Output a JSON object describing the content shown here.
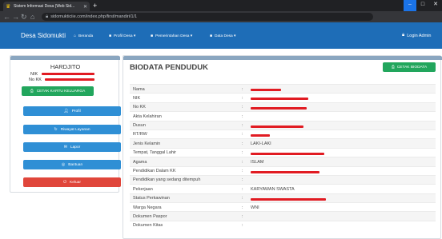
{
  "browser": {
    "tab_title": "Sistem Informasi Desa (Web Sid...",
    "url": "sidomukticiie.com/index.php/first/mandiri/1/1"
  },
  "navbar": {
    "brand": "Desa Sidomukti",
    "items": [
      {
        "label": "Beranda",
        "icon": "home-icon"
      },
      {
        "label": "Profil Desa ▾",
        "icon": "profile-icon"
      },
      {
        "label": "Pemerintahan Desa ▾",
        "icon": "gov-icon"
      },
      {
        "label": "Data Desa ▾",
        "icon": "data-icon"
      }
    ],
    "login_label": "Login Admin"
  },
  "sidebar": {
    "name": "HARDJITO",
    "nik_label": "NIK",
    "kk_label": "No KK",
    "print_card_label": "CETAK KARTU KELUARGA",
    "buttons": [
      {
        "label": "Profil",
        "icon": "user-icon",
        "color": "#2f8fd5"
      },
      {
        "label": "Riwayat Layanan",
        "icon": "history-icon",
        "color": "#2f8fd5"
      },
      {
        "label": "Lapor",
        "icon": "report-icon",
        "color": "#2f8fd5"
      },
      {
        "label": "Bantuan",
        "icon": "help-icon",
        "color": "#2f8fd5"
      },
      {
        "label": "Keluar",
        "icon": "logout-icon",
        "color": "#e0463b"
      }
    ]
  },
  "main": {
    "title": "BIODATA PENDUDUK",
    "print_label": "CETAK BIODATA",
    "rows": [
      {
        "label": "Nama",
        "value": "",
        "redacted": true
      },
      {
        "label": "NIK",
        "value": "",
        "redacted": true
      },
      {
        "label": "No KK",
        "value": "",
        "redacted": true
      },
      {
        "label": "Akta Kelahiran",
        "value": "",
        "redacted": false
      },
      {
        "label": "Dusun",
        "value": "",
        "redacted": true
      },
      {
        "label": "RT/RW",
        "value": "",
        "redacted": true
      },
      {
        "label": "Jenis Kelamin",
        "value": "LAKI-LAKI",
        "redacted": false
      },
      {
        "label": "Tempat, Tanggal Lahir",
        "value": "",
        "redacted": true
      },
      {
        "label": "Agama",
        "value": "ISLAM",
        "redacted": false
      },
      {
        "label": "Pendidikan Dalam KK",
        "value": "",
        "redacted": true
      },
      {
        "label": "Pendidikan yang sedang ditempuh",
        "value": "",
        "redacted": false
      },
      {
        "label": "Pekerjaan",
        "value": "KARYAWAN SWASTA",
        "redacted": false
      },
      {
        "label": "Status Perkawinan",
        "value": "",
        "redacted": true
      },
      {
        "label": "Warga Negara",
        "value": "WNI",
        "redacted": false
      },
      {
        "label": "Dokumen Paspor",
        "value": "",
        "redacted": false
      },
      {
        "label": "Dokumen Kitas",
        "value": "",
        "redacted": false
      }
    ]
  },
  "colors": {
    "navbar": "#1e6db7",
    "primary_button": "#2f8fd5",
    "success_button": "#22a65d",
    "danger_button": "#e0463b",
    "redaction": "#e11b22"
  }
}
